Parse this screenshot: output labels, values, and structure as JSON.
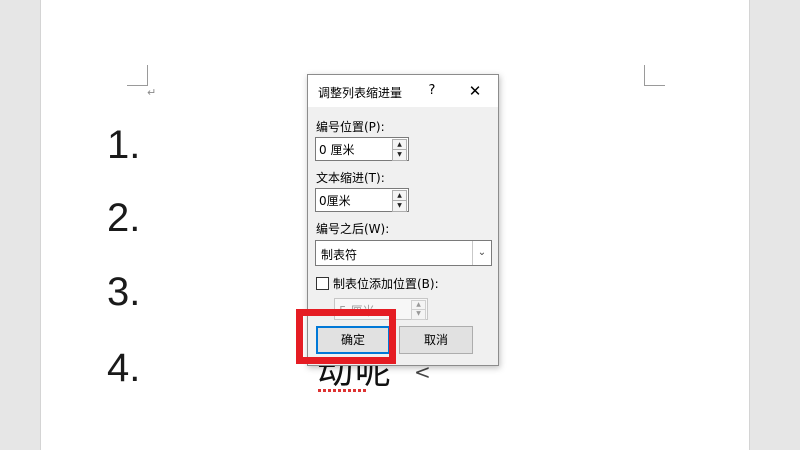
{
  "document": {
    "para_mark": "↵",
    "list_numbers": [
      "1.",
      "2.",
      "3.",
      "4."
    ],
    "bg_text": "动呢",
    "selection_arrow": "<"
  },
  "dialog": {
    "title": "调整列表缩进量",
    "help_label": "?",
    "close_label": "✕",
    "number_position": {
      "label": "编号位置(P):",
      "value": "0 厘米"
    },
    "text_indent": {
      "label": "文本缩进(T):",
      "value": "0厘米"
    },
    "follow_number": {
      "label": "编号之后(W):",
      "value": "制表符",
      "arrow": "⌄"
    },
    "tab_stop": {
      "checked": false,
      "label": "制表位添加位置(B):",
      "value": "5 厘米"
    },
    "ok_label": "确定",
    "cancel_label": "取消"
  },
  "icons": {
    "spin_up": "▲",
    "spin_down": "▼"
  },
  "colors": {
    "highlight": "#e51c23",
    "focus_blue": "#0078d7"
  }
}
